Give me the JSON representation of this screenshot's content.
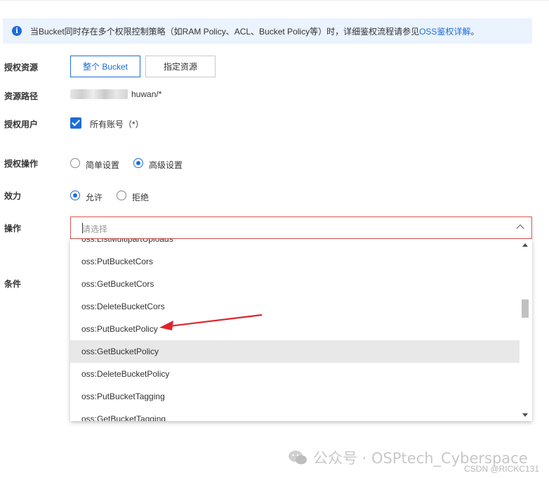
{
  "notice": {
    "text": "当Bucket同时存在多个权限控制策略（如RAM Policy、ACL、Bucket Policy等）时，详细鉴权流程请参见",
    "link": "OSS鉴权详解",
    "end": "。",
    "icon": "info-icon"
  },
  "form": {
    "resource_label": "授权资源",
    "resource_options": [
      "整个 Bucket",
      "指定资源"
    ],
    "path_label": "资源路径",
    "path_value": "huwan/*",
    "user_label": "授权用户",
    "user_checkbox_label": "所有账号（*）",
    "operation_mode_label": "授权操作",
    "operation_modes": [
      "简单设置",
      "高级设置"
    ],
    "effect_label": "效力",
    "effects": [
      "允许",
      "拒绝"
    ],
    "action_label": "操作",
    "action_placeholder": "请选择",
    "condition_label": "条件"
  },
  "dropdown": {
    "options": [
      "oss:ListMultipartUploads",
      "oss:PutBucketCors",
      "oss:GetBucketCors",
      "oss:DeleteBucketCors",
      "oss:PutBucketPolicy",
      "oss:GetBucketPolicy",
      "oss:DeleteBucketPolicy",
      "oss:PutBucketTagging",
      "oss:GetBucketTagging"
    ],
    "highlighted": "oss:GetBucketPolicy",
    "annotated": "oss:PutBucketPolicy"
  },
  "watermark": {
    "text": "公众号 · OSPtech_Cyberspace",
    "credit": "CSDN @RICKC131"
  },
  "colors": {
    "accent": "#1c6dd9",
    "error_border": "#d9534f",
    "annotation_arrow": "#e0242a"
  }
}
